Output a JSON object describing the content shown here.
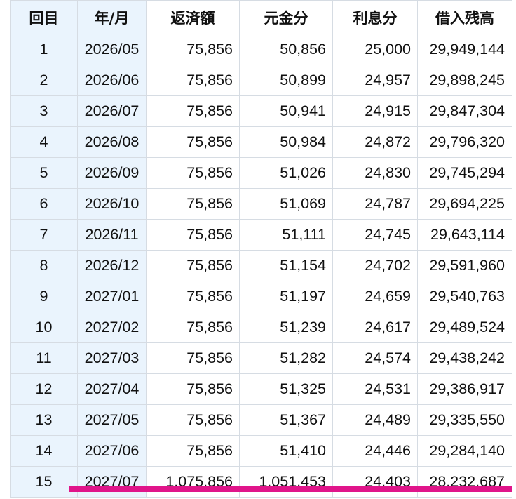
{
  "header": {
    "no": "回目",
    "ym": "年/月",
    "payment": "返済額",
    "principal": "元金分",
    "interest": "利息分",
    "balance": "借入残高"
  },
  "rows": [
    {
      "no": "1",
      "ym": "2026/05",
      "payment": "75,856",
      "principal": "50,856",
      "interest": "25,000",
      "balance": "29,949,144"
    },
    {
      "no": "2",
      "ym": "2026/06",
      "payment": "75,856",
      "principal": "50,899",
      "interest": "24,957",
      "balance": "29,898,245"
    },
    {
      "no": "3",
      "ym": "2026/07",
      "payment": "75,856",
      "principal": "50,941",
      "interest": "24,915",
      "balance": "29,847,304"
    },
    {
      "no": "4",
      "ym": "2026/08",
      "payment": "75,856",
      "principal": "50,984",
      "interest": "24,872",
      "balance": "29,796,320"
    },
    {
      "no": "5",
      "ym": "2026/09",
      "payment": "75,856",
      "principal": "51,026",
      "interest": "24,830",
      "balance": "29,745,294"
    },
    {
      "no": "6",
      "ym": "2026/10",
      "payment": "75,856",
      "principal": "51,069",
      "interest": "24,787",
      "balance": "29,694,225"
    },
    {
      "no": "7",
      "ym": "2026/11",
      "payment": "75,856",
      "principal": "51,111",
      "interest": "24,745",
      "balance": "29,643,114"
    },
    {
      "no": "8",
      "ym": "2026/12",
      "payment": "75,856",
      "principal": "51,154",
      "interest": "24,702",
      "balance": "29,591,960"
    },
    {
      "no": "9",
      "ym": "2027/01",
      "payment": "75,856",
      "principal": "51,197",
      "interest": "24,659",
      "balance": "29,540,763"
    },
    {
      "no": "10",
      "ym": "2027/02",
      "payment": "75,856",
      "principal": "51,239",
      "interest": "24,617",
      "balance": "29,489,524"
    },
    {
      "no": "11",
      "ym": "2027/03",
      "payment": "75,856",
      "principal": "51,282",
      "interest": "24,574",
      "balance": "29,438,242"
    },
    {
      "no": "12",
      "ym": "2027/04",
      "payment": "75,856",
      "principal": "51,325",
      "interest": "24,531",
      "balance": "29,386,917"
    },
    {
      "no": "13",
      "ym": "2027/05",
      "payment": "75,856",
      "principal": "51,367",
      "interest": "24,489",
      "balance": "29,335,550"
    },
    {
      "no": "14",
      "ym": "2027/06",
      "payment": "75,856",
      "principal": "51,410",
      "interest": "24,446",
      "balance": "29,284,140"
    },
    {
      "no": "15",
      "ym": "2027/07",
      "payment": "1,075,856",
      "principal": "1,051,453",
      "interest": "24,403",
      "balance": "28,232,687"
    }
  ],
  "colors": {
    "header_blue": "#eaf4fd",
    "highlight_underline": "#e0158a",
    "grid_border": "#d6dce3"
  }
}
